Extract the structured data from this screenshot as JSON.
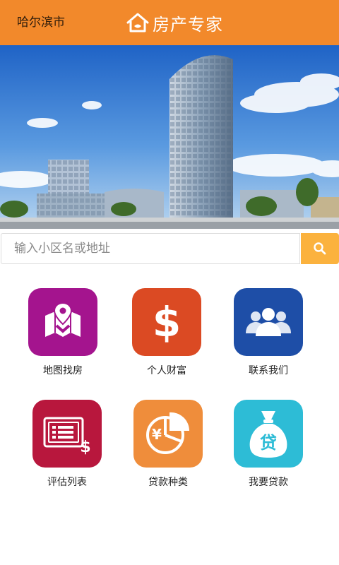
{
  "header": {
    "city": "哈尔滨市",
    "title": "房产专家",
    "logo_icon": "house-icon",
    "background_color": "#f2892b"
  },
  "banner": {
    "image": "city-office-tower-photo"
  },
  "search": {
    "placeholder": "输入小区名或地址",
    "value": "",
    "button_icon": "search-icon",
    "button_color": "#fbb23e"
  },
  "grid": {
    "items": [
      {
        "label": "地图找房",
        "icon": "map-pin-icon",
        "color": "#a4148e"
      },
      {
        "label": "个人财富",
        "icon": "dollar-icon",
        "color": "#db4a23"
      },
      {
        "label": "联系我们",
        "icon": "people-icon",
        "color": "#1e4ea7"
      },
      {
        "label": "评估列表",
        "icon": "price-list-icon",
        "color": "#b8173d"
      },
      {
        "label": "贷款种类",
        "icon": "yen-pie-chart-icon",
        "color": "#ef8d3b"
      },
      {
        "label": "我要贷款",
        "icon": "money-bag-icon",
        "color": "#2dbcd6"
      }
    ]
  }
}
